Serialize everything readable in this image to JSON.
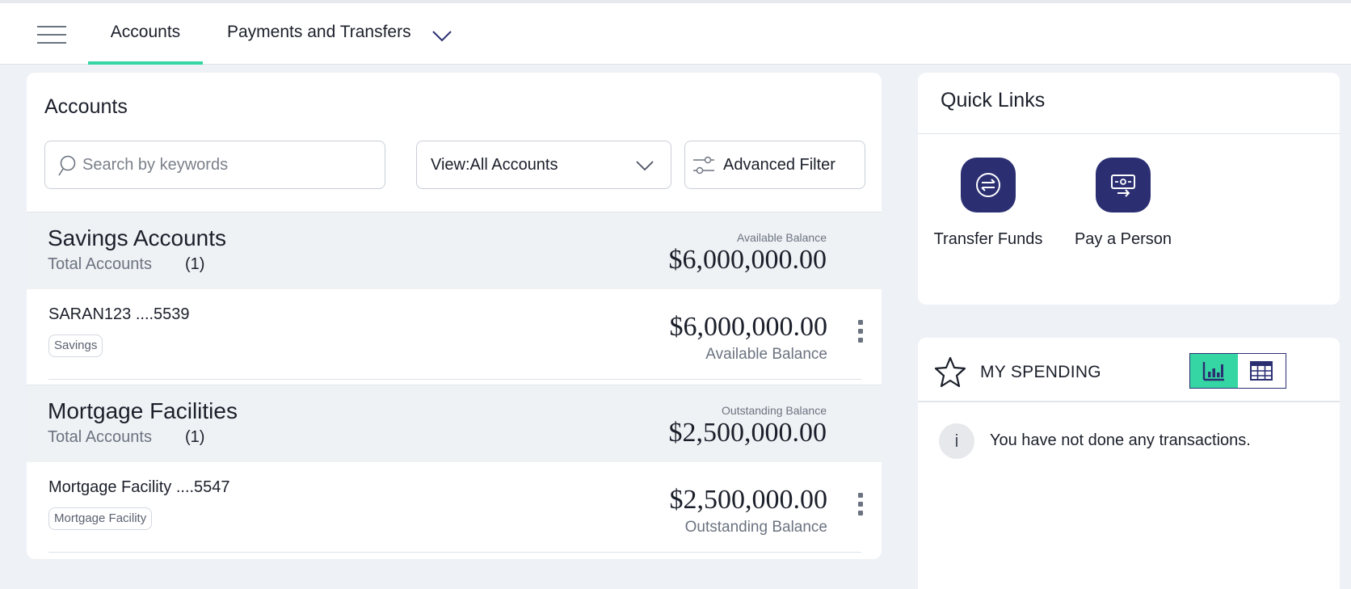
{
  "nav": {
    "tabs": [
      {
        "label": "Accounts",
        "active": true
      },
      {
        "label": "Payments and Transfers",
        "active": false
      }
    ]
  },
  "accounts": {
    "title": "Accounts",
    "search_placeholder": "Search by keywords",
    "view_label": "View:All Accounts",
    "advanced_filter_label": "Advanced Filter",
    "groups": [
      {
        "name": "Savings Accounts",
        "total_label": "Total Accounts",
        "count": "(1)",
        "balance_caption": "Available Balance",
        "balance": "$6,000,000.00",
        "rows": [
          {
            "name": "SARAN123 ....5539",
            "tag": "Savings",
            "amount": "$6,000,000.00",
            "caption": "Available Balance"
          }
        ]
      },
      {
        "name": "Mortgage Facilities",
        "total_label": "Total Accounts",
        "count": "(1)",
        "balance_caption": "Outstanding Balance",
        "balance": "$2,500,000.00",
        "rows": [
          {
            "name": "Mortgage Facility ....5547",
            "tag": "Mortgage Facility",
            "amount": "$2,500,000.00",
            "caption": "Outstanding Balance"
          }
        ]
      }
    ]
  },
  "quick_links": {
    "title": "Quick Links",
    "items": [
      {
        "label": "Transfer Funds",
        "icon": "transfer-icon"
      },
      {
        "label": "Pay a Person",
        "icon": "pay-person-icon"
      }
    ]
  },
  "spending": {
    "title": "MY SPENDING",
    "empty_message": "You have not done any transactions.",
    "info_glyph": "i",
    "view": "chart"
  },
  "colors": {
    "accent": "#35d6a3",
    "brand": "#2b2f72"
  }
}
